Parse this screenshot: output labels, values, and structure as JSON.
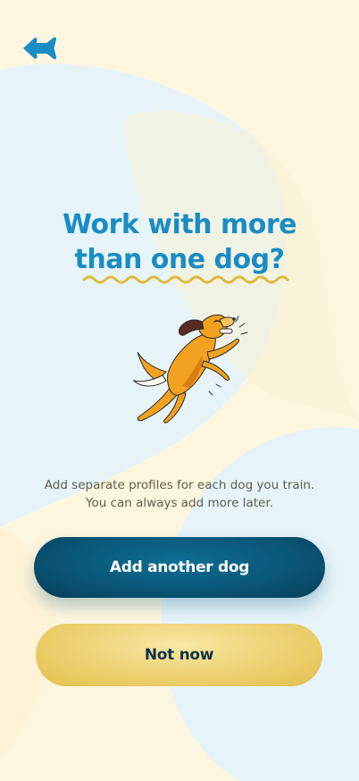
{
  "colors": {
    "background": "#fdf6df",
    "blob": "#e6f4f9",
    "accent_blue": "#1a8cc4",
    "squiggle": "#e3b93b",
    "primary_button": "#0a5677",
    "secondary_button": "#efd47a"
  },
  "header": {
    "back_icon": "fish-shaped-back-arrow-icon"
  },
  "hero": {
    "title_line_1": "Work with more",
    "title_line_2": "than one dog?",
    "illustration": "jumping-dog-illustration"
  },
  "body": {
    "line_1": "Add separate profiles for each dog you train.",
    "line_2": "You can always add more later."
  },
  "actions": {
    "primary_label": "Add another dog",
    "secondary_label": "Not now"
  }
}
